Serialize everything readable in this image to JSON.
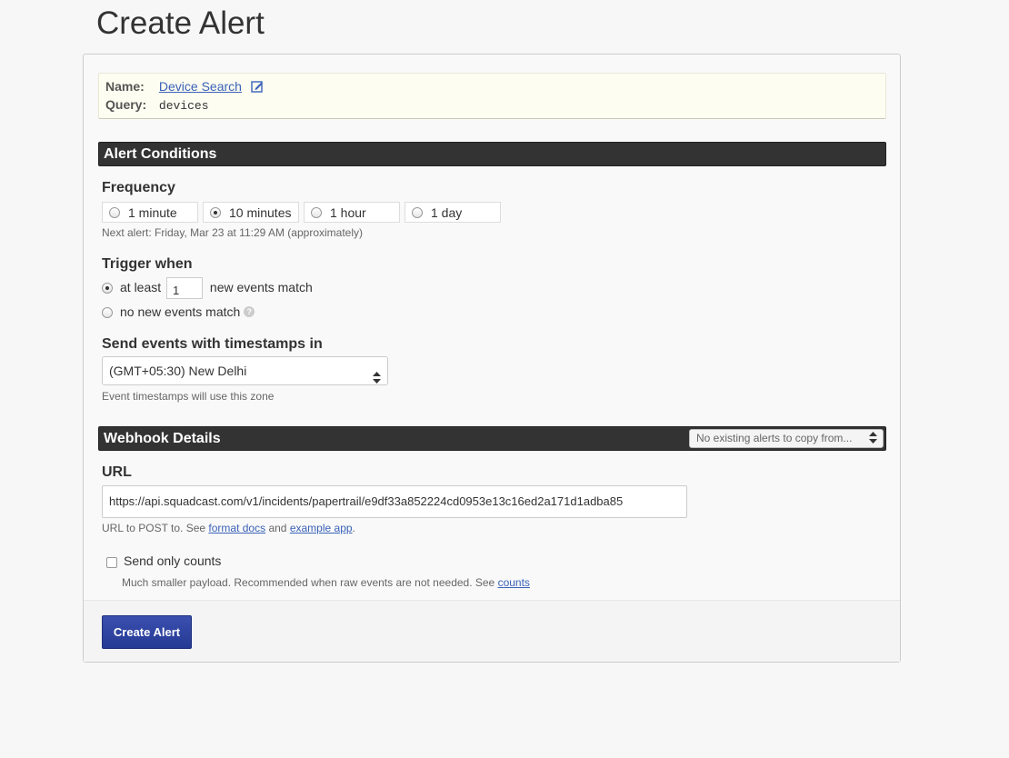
{
  "page": {
    "title": "Create Alert"
  },
  "search": {
    "name_label": "Name:",
    "name": "Device Search",
    "query_label": "Query:",
    "query": "devices"
  },
  "conditions": {
    "header": "Alert Conditions",
    "frequency_label": "Frequency",
    "frequency_options": [
      {
        "label": "1 minute",
        "selected": false
      },
      {
        "label": "10 minutes",
        "selected": true
      },
      {
        "label": "1 hour",
        "selected": false
      },
      {
        "label": "1 day",
        "selected": false
      }
    ],
    "next_alert": "Next alert: Friday, Mar 23 at 11:29 AM (approximately)",
    "trigger_label": "Trigger when",
    "trigger_at_least": "at least",
    "trigger_count": "1",
    "trigger_new_events": "new events match",
    "trigger_no_new": "no new events match",
    "help_glyph": "?",
    "timezone_label": "Send events with timestamps in",
    "timezone_value": "(GMT+05:30) New Delhi",
    "timezone_hint": "Event timestamps will use this zone"
  },
  "webhook": {
    "header": "Webhook Details",
    "copy_placeholder": "No existing alerts to copy from...",
    "url_label": "URL",
    "url_value": "https://api.squadcast.com/v1/incidents/papertrail/e9df33a852224cd0953e13c16ed2a171d1adba85",
    "url_hint_prefix": "URL to POST to. See",
    "format_docs": "format docs",
    "url_hint_and": "and",
    "example_app": "example app",
    "url_hint_suffix": ".",
    "send_counts_label": "Send only counts",
    "counts_hint_prefix": "Much smaller payload. Recommended when raw events are not needed. See",
    "counts_link": "counts"
  },
  "actions": {
    "create_label": "Create Alert"
  },
  "colors": {
    "accent": "#2f44a2",
    "link": "#3a62b8",
    "section_bar": "#333333"
  },
  "icons": {
    "edit": "edit-icon",
    "help": "help-icon",
    "select": "select-arrows-icon"
  }
}
